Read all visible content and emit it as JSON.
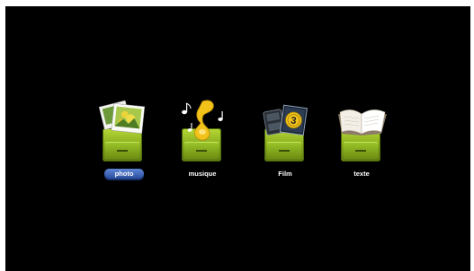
{
  "menu": {
    "items": [
      {
        "label": "photo",
        "icon": "photo-icon",
        "selected": true
      },
      {
        "label": "musique",
        "icon": "music-icon",
        "selected": false
      },
      {
        "label": "Film",
        "icon": "film-icon",
        "selected": false
      },
      {
        "label": "texte",
        "icon": "book-icon",
        "selected": false
      }
    ]
  },
  "colors": {
    "background": "#000000",
    "folder": "#8fb624",
    "selection": "#3a62b8",
    "label": "#ffffff"
  }
}
